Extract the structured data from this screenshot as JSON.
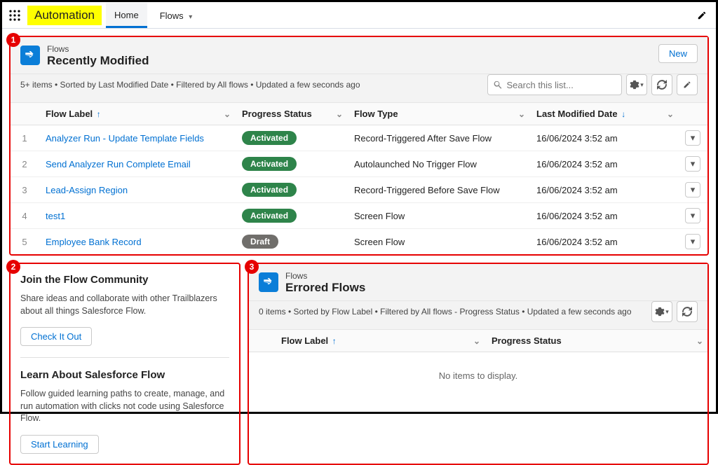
{
  "nav": {
    "app_name": "Automation",
    "tabs": [
      {
        "label": "Home",
        "active": true,
        "has_dropdown": false
      },
      {
        "label": "Flows",
        "active": false,
        "has_dropdown": true
      }
    ]
  },
  "recent": {
    "eyebrow": "Flows",
    "title": "Recently Modified",
    "meta": "5+ items • Sorted by Last Modified Date • Filtered by All flows • Updated a few seconds ago",
    "search_placeholder": "Search this list...",
    "new_label": "New",
    "columns": {
      "label": "Flow Label",
      "status": "Progress Status",
      "type": "Flow Type",
      "date": "Last Modified Date"
    },
    "rows": [
      {
        "n": "1",
        "label": "Analyzer Run - Update Template Fields",
        "status": "Activated",
        "status_kind": "activated",
        "type": "Record-Triggered After Save Flow",
        "date": "16/06/2024 3:52 am"
      },
      {
        "n": "2",
        "label": "Send Analyzer Run Complete Email",
        "status": "Activated",
        "status_kind": "activated",
        "type": "Autolaunched No Trigger Flow",
        "date": "16/06/2024 3:52 am"
      },
      {
        "n": "3",
        "label": "Lead-Assign Region",
        "status": "Activated",
        "status_kind": "activated",
        "type": "Record-Triggered Before Save Flow",
        "date": "16/06/2024 3:52 am"
      },
      {
        "n": "4",
        "label": "test1",
        "status": "Activated",
        "status_kind": "activated",
        "type": "Screen Flow",
        "date": "16/06/2024 3:52 am"
      },
      {
        "n": "5",
        "label": "Employee Bank Record",
        "status": "Draft",
        "status_kind": "draft",
        "type": "Screen Flow",
        "date": "16/06/2024 3:52 am"
      }
    ]
  },
  "community": {
    "title": "Join the Flow Community",
    "body": "Share ideas and collaborate with other Trailblazers about all things Salesforce Flow.",
    "cta": "Check It Out"
  },
  "learn": {
    "title": "Learn About Salesforce Flow",
    "body": "Follow guided learning paths to create, manage, and run automation with clicks not code using Salesforce Flow.",
    "cta": "Start Learning"
  },
  "errored": {
    "eyebrow": "Flows",
    "title": "Errored Flows",
    "meta": "0 items • Sorted by Flow Label • Filtered by All flows - Progress Status • Updated a few seconds ago",
    "columns": {
      "label": "Flow Label",
      "status": "Progress Status"
    },
    "empty": "No items to display."
  },
  "badges": {
    "one": "1",
    "two": "2",
    "three": "3"
  },
  "icons": {
    "gear": "gear-icon",
    "refresh": "refresh-icon",
    "pencil": "pencil-icon",
    "search": "search-icon",
    "caret_down": "▾"
  }
}
